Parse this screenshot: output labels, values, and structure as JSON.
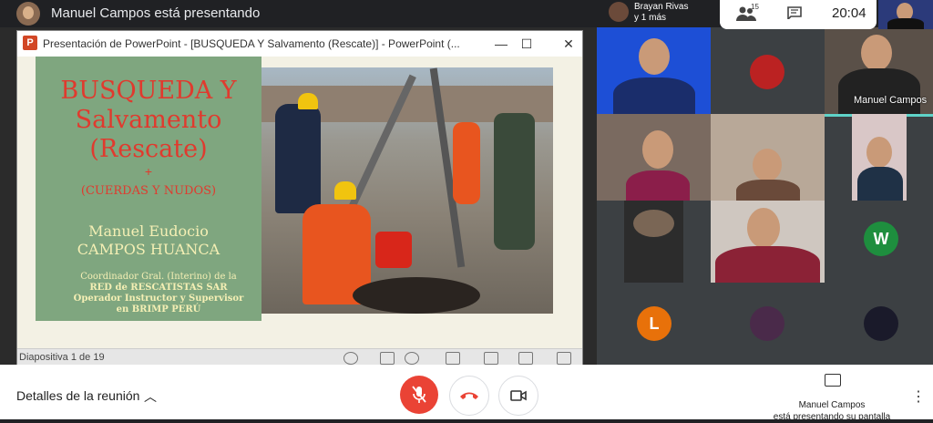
{
  "presenter": {
    "title": "Manuel Campos está presentando"
  },
  "ppt": {
    "window_title": "Presentación de PowerPoint - [BUSQUEDA Y Salvamento (Rescate)] - PowerPoint (...",
    "slide": {
      "title_line1": "BUSQUEDA Y",
      "title_line2": "Salvamento",
      "title_line3": "(Rescate)",
      "plus": "+",
      "subtitle": "(CUERDAS Y NUDOS)",
      "name_line1": "Manuel Eudocio",
      "name_line2": "CAMPOS HUANCA",
      "role_line1": "Coordinador Gral. (Interino) de la",
      "role_line2": "RED de RESCATISTAS SAR",
      "role_line3": "Operador Instructor y Supervisor",
      "role_line4": "en BRIMP PERÚ"
    },
    "status": {
      "slide_counter": "Diapositiva 1 de 19"
    }
  },
  "top": {
    "raised_hand_name": "Brayan Rivas",
    "raised_hand_more": "y 1 más",
    "people_count": "15",
    "clock": "20:04"
  },
  "grid": {
    "tile_name_manuel": "Manuel Campos",
    "avatar_w": "W",
    "avatar_l": "L"
  },
  "bottom": {
    "meeting_details": "Detalles de la reunión",
    "presenter_name": "Manuel Campos",
    "presenting_label": "está presentando su pantalla"
  },
  "colors": {
    "end_call": "#ea4335",
    "mic_muted": "#ea4335",
    "avatar_w": "#1e8e3e",
    "avatar_l": "#e8710a"
  }
}
